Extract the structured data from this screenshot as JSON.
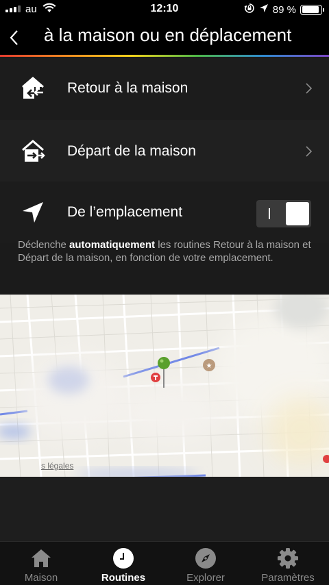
{
  "status_bar": {
    "carrier": "au",
    "time": "12:10",
    "battery": "89 %",
    "battery_level": 0.89
  },
  "header": {
    "title": "à la maison ou en déplacement"
  },
  "rows": [
    {
      "label": "Retour à la maison",
      "icon": "home-return-icon"
    },
    {
      "label": "Départ de la maison",
      "icon": "home-leave-icon"
    }
  ],
  "location": {
    "label": "De l’emplacement",
    "toggle_on": true,
    "toggle_on_symbol": "I"
  },
  "description": {
    "before": "Déclenche ",
    "bold": "automatiquement",
    "after": " les routines Retour à la maison et Départ de la maison, en fonction de votre emplacement."
  },
  "map": {
    "legal_text": "s légales"
  },
  "tabs": [
    {
      "label": "Maison",
      "icon": "house-icon",
      "active": false
    },
    {
      "label": "Routines",
      "icon": "clock-icon",
      "active": true
    },
    {
      "label": "Explorer",
      "icon": "compass-icon",
      "active": false
    },
    {
      "label": "Paramètres",
      "icon": "gear-icon",
      "active": false
    }
  ],
  "colors": {
    "accent_pin": "#5aa02c",
    "pin_red": "#e04040",
    "route_blue": "#5a7fe0"
  }
}
